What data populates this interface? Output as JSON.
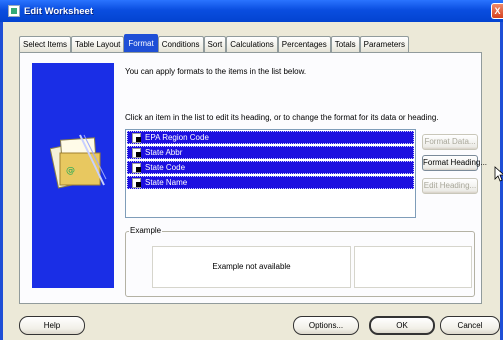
{
  "window": {
    "title": "Edit Worksheet",
    "close_symbol": "X"
  },
  "tabs": [
    {
      "label": "Select Items",
      "active": false
    },
    {
      "label": "Table Layout",
      "active": false
    },
    {
      "label": "Format",
      "active": true
    },
    {
      "label": "Conditions",
      "active": false
    },
    {
      "label": "Sort",
      "active": false
    },
    {
      "label": "Calculations",
      "active": false
    },
    {
      "label": "Percentages",
      "active": false
    },
    {
      "label": "Totals",
      "active": false
    },
    {
      "label": "Parameters",
      "active": false
    }
  ],
  "panel": {
    "intro_text": "You can apply formats to the items in the list below.",
    "instruction_text": "Click an item in the list to edit its heading, or to change the format for its data or heading.",
    "items": [
      {
        "label": "EPA Region Code"
      },
      {
        "label": "State Abbr"
      },
      {
        "label": "State Code"
      },
      {
        "label": "State Name"
      }
    ],
    "buttons": {
      "format_data": "Format Data...",
      "format_heading": "Format Heading...",
      "edit_heading": "Edit Heading..."
    },
    "example": {
      "label": "Example",
      "text": "Example not available"
    }
  },
  "footer": {
    "help": "Help",
    "options": "Options...",
    "ok": "OK",
    "cancel": "Cancel"
  },
  "colors": {
    "titlebar": "#0a4ee0",
    "selection": "#1c0fe0",
    "side_art": "#1a2ee6",
    "background": "#7a1f6e"
  }
}
